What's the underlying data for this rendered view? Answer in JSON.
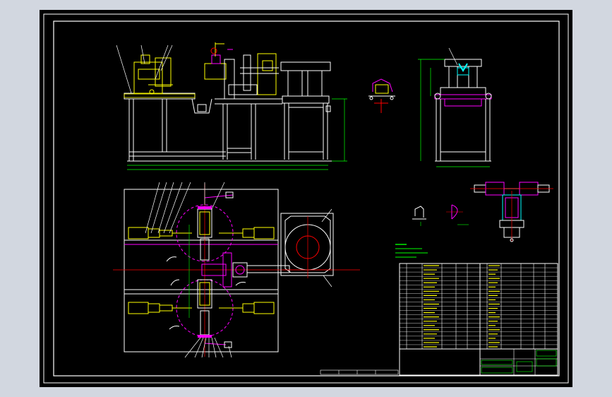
{
  "viewer": {
    "background": "#d2d7e0",
    "canvas_color": "#000000",
    "frame_color": "#ffffff"
  },
  "drawing": {
    "colors": {
      "white": "#ffffff",
      "yellow": "#ffff00",
      "green": "#00ff00",
      "red": "#ff0000",
      "magenta": "#ff00ff",
      "cyan": "#00ffff",
      "blue": "#4a6cff"
    },
    "views": [
      "front-elevation-view",
      "side-elevation-view",
      "bracket-detail-view",
      "plan-view",
      "cylinder-detail-view",
      "small-part-detail-view",
      "parts-list-table",
      "title-block"
    ],
    "parts_table": {
      "rows": 20,
      "column_groups": 2,
      "legible_text": ""
    }
  }
}
